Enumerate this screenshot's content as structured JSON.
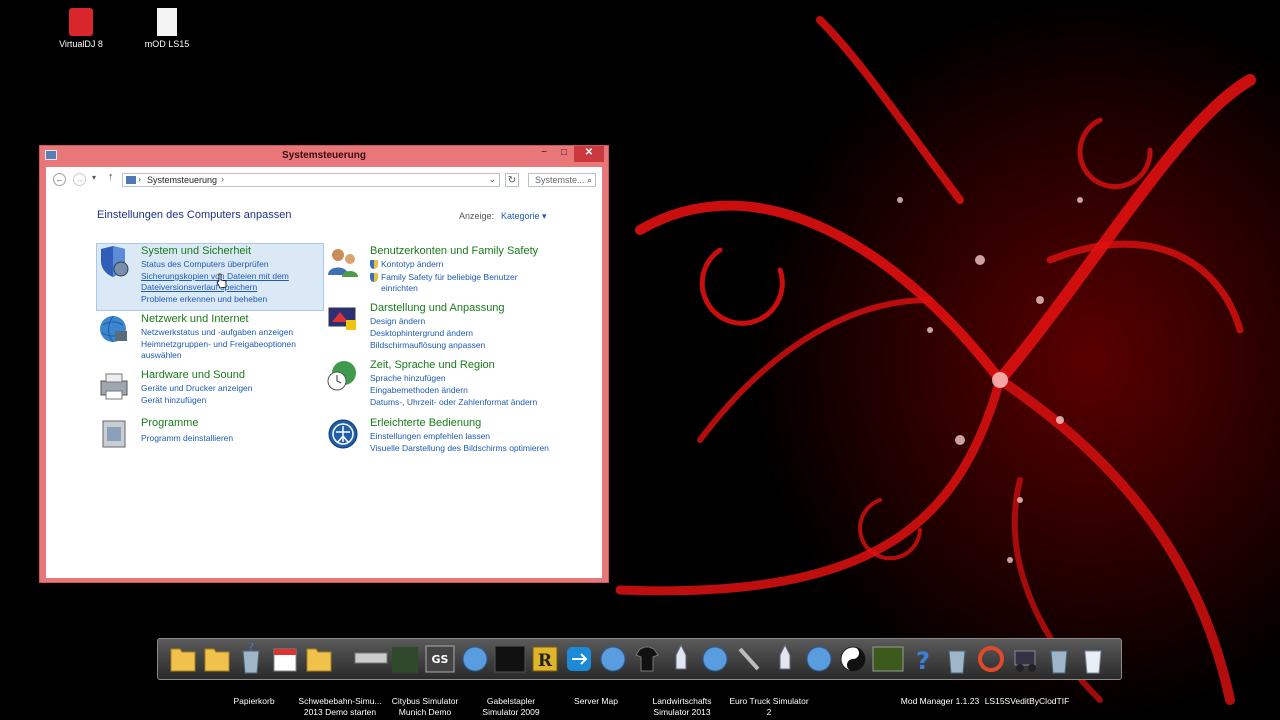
{
  "desktop": {
    "icons": [
      {
        "label": "VirtualDJ 8"
      },
      {
        "label": "mOD  LS15"
      }
    ]
  },
  "window": {
    "title": "Systemsteuerung",
    "controls": {
      "minimize": "−",
      "maximize": "□",
      "close": "✕"
    },
    "address": {
      "crumb": "Systemsteuerung",
      "separator": "›",
      "search_placeholder": "Systemste..."
    },
    "heading": "Einstellungen des Computers anpassen",
    "view": {
      "label": "Anzeige:",
      "value": "Kategorie ▾"
    },
    "categories": {
      "security": {
        "title": "System und Sicherheit",
        "links": [
          "Status des Computers überprüfen",
          "Sicherungskopien von Dateien mit dem",
          "Dateiversionsverlauf speichern",
          "Probleme erkennen und beheben"
        ]
      },
      "network": {
        "title": "Netzwerk und Internet",
        "links": [
          "Netzwerkstatus und -aufgaben anzeigen",
          "Heimnetzgruppen- und Freigabeoptionen",
          "auswählen"
        ]
      },
      "hardware": {
        "title": "Hardware und Sound",
        "links": [
          "Geräte und Drucker anzeigen",
          "Gerät hinzufügen"
        ]
      },
      "programs": {
        "title": "Programme",
        "links": [
          "Programm deinstallieren"
        ]
      },
      "accounts": {
        "title": "Benutzerkonten und Family Safety",
        "links": [
          "Kontotyp ändern",
          "Family Safety für beliebige Benutzer",
          "einrichten"
        ]
      },
      "appearance": {
        "title": "Darstellung und Anpassung",
        "links": [
          "Design ändern",
          "Desktophintergrund ändern",
          "Bildschirmauflösung anpassen"
        ]
      },
      "clock": {
        "title": "Zeit, Sprache und Region",
        "links": [
          "Sprache hinzufügen",
          "Eingabemethoden ändern",
          "Datums-, Uhrzeit- oder Zahlenformat ändern"
        ]
      },
      "ease": {
        "title": "Erleichterte Bedienung",
        "links": [
          "Einstellungen empfehlen lassen",
          "Visuelle Darstellung des Bildschirms optimieren"
        ]
      }
    }
  },
  "dock": {
    "labels": [
      {
        "text": "Papierkorb"
      },
      {
        "text": "Schwebebahn-Simu... 2013 Demo starten"
      },
      {
        "text": "Citybus Simulator Munich Demo"
      },
      {
        "text": "Gabelstapler Simulator 2009"
      },
      {
        "text": "Server Map"
      },
      {
        "text": "Landwirtschafts Simulator 2013"
      },
      {
        "text": "Euro Truck Simulator 2"
      },
      {
        "text": "Mod Manager 1.1.23"
      },
      {
        "text": "LS15SVeditByClodTIF"
      }
    ]
  }
}
